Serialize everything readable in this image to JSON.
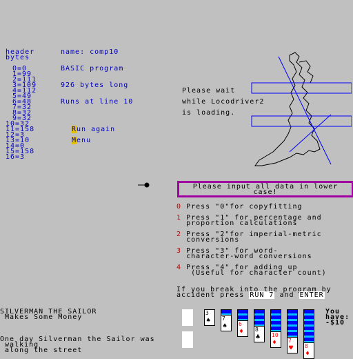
{
  "header_bytes_label": "header\nbytes",
  "bytes": [
    "0=0",
    "1=99",
    "2=111",
    "3=109",
    "4=112",
    "5=49",
    "6=48",
    "7=32",
    "8=32",
    "9=32",
    "10=32",
    "11=158",
    "12=3",
    "13=10",
    "14=0",
    "15=158",
    "16=3"
  ],
  "file_info": {
    "name": "name: comp10",
    "type": "BASIC program",
    "length": "926 bytes long",
    "runs": "Runs at line 10"
  },
  "menu": {
    "run_again_key": "R",
    "run_again_rest": "un again",
    "menu_key": "M",
    "menu_rest": "enu"
  },
  "loading": {
    "line1": "Please wait",
    "line2": "while Locodriver2",
    "line3": "is loading."
  },
  "input_prompt": "Please input all data in lower\ncase!",
  "options": [
    {
      "num": "0",
      "text": "Press \"0\"for copyfitting"
    },
    {
      "num": "1",
      "text": "Press \"1\" for percentage and\nproportion calculations"
    },
    {
      "num": "2",
      "text": "Press \"2\"for imperial-metric\nconversions"
    },
    {
      "num": "3",
      "text": "Press \"3\" for word-\ncharacter-word conversions"
    },
    {
      "num": "4",
      "text": "Press \"4\" for adding up\n (Useful for character count)"
    }
  ],
  "break_notice": {
    "line1": "If you break into the program by",
    "line2_pre": "accident press ",
    "key1": "RUN 7",
    "and": " and ",
    "key2": "ENTER"
  },
  "story": {
    "title": "SILVERMAN THE SAILOR",
    "subtitle": " Makes Some Money",
    "line1": "One day Silverman the Sailor was",
    "line2": " walking",
    "line3": " along the street"
  },
  "money": {
    "you": "You",
    "have": "have:",
    "amount": "-$10"
  },
  "cards": [
    {
      "value": "3",
      "suit": "♠",
      "color": "#000"
    },
    {
      "value": "7",
      "suit": "♠",
      "color": "#000"
    },
    {
      "value": "6",
      "suit": "♦",
      "color": "#ff0000"
    },
    {
      "value": "8",
      "suit": "♣",
      "color": "#000"
    },
    {
      "value": "10",
      "suit": "♦",
      "color": "#ff0000"
    },
    {
      "value": "7",
      "suit": "♥",
      "color": "#ff0000"
    },
    {
      "value": "8",
      "suit": "♦",
      "color": "#ff0000"
    }
  ],
  "colors": {
    "magenta": "#a000a0",
    "blue_text": "#0000c0",
    "red_num": "#c00000",
    "highlight": "#e0c000"
  }
}
